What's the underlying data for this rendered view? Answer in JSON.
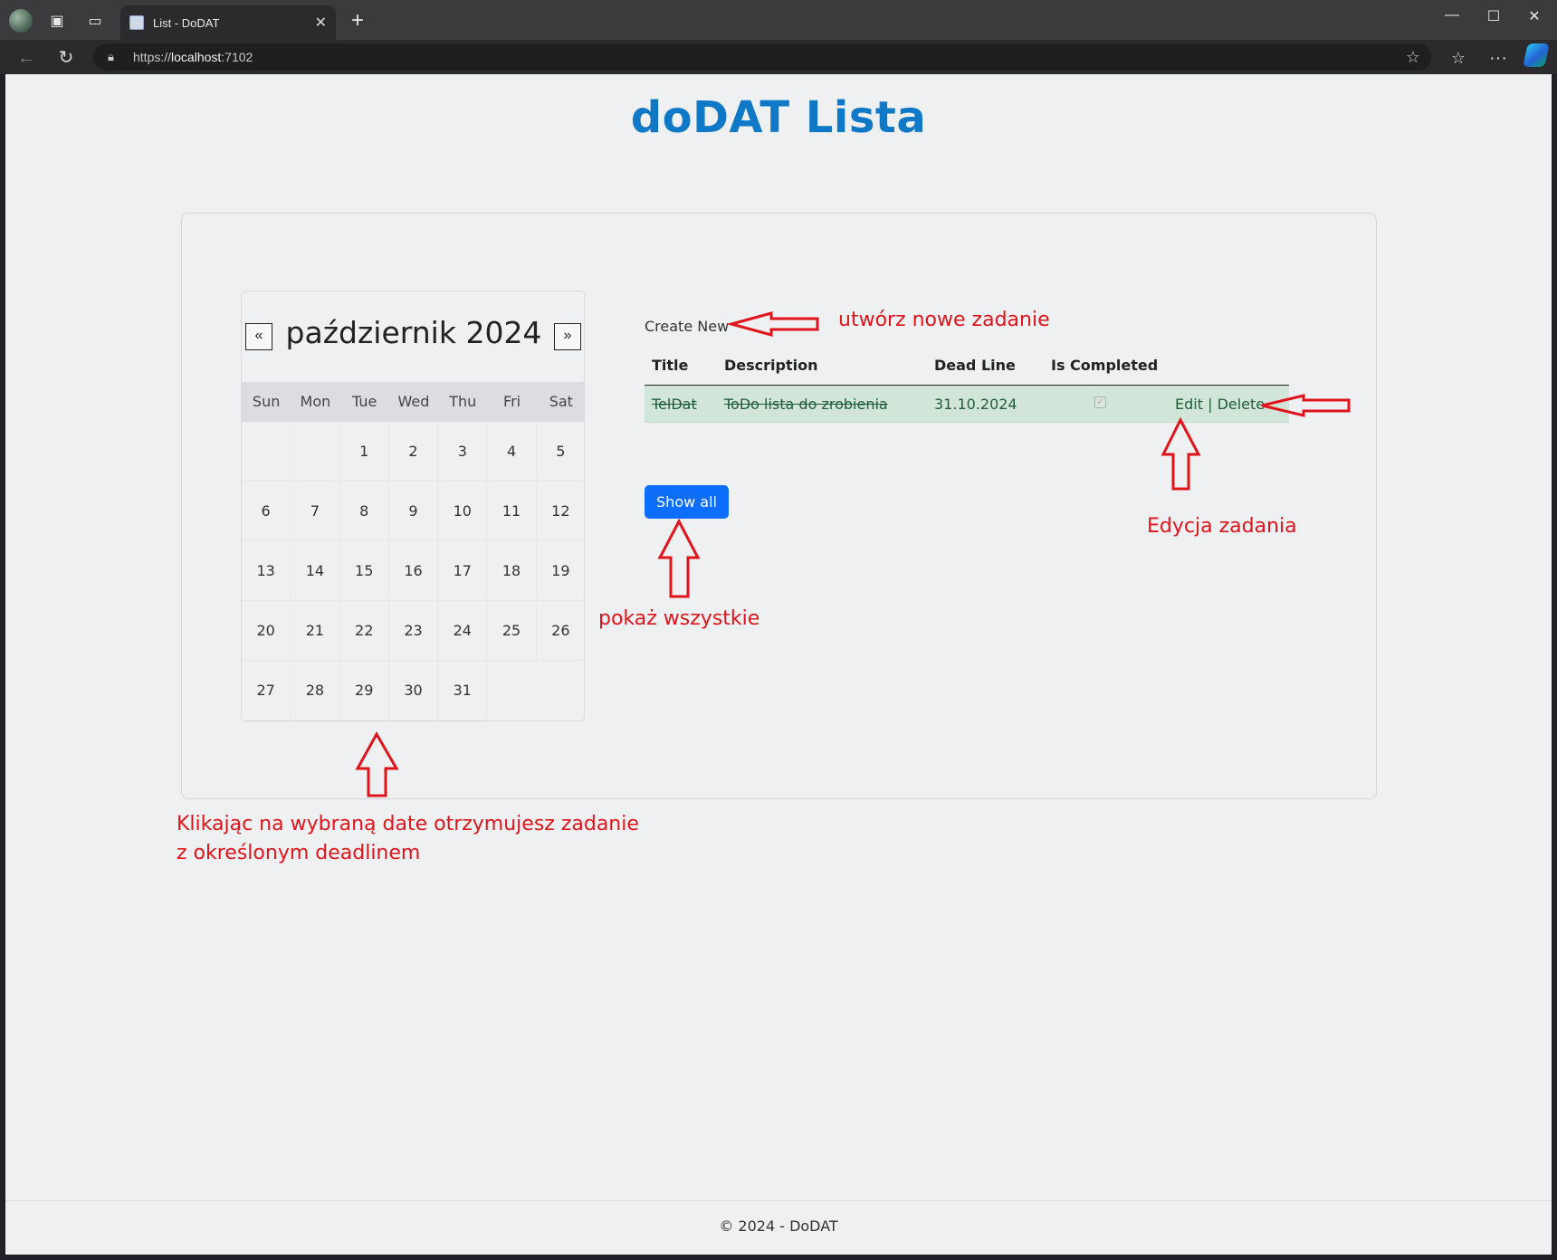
{
  "browser": {
    "tab_title": "List - DoDAT",
    "url_scheme": "https://",
    "url_host": "localhost",
    "url_rest": ":7102"
  },
  "page": {
    "brand": "doDAT Lista",
    "footer": "© 2024 - DoDAT"
  },
  "calendar": {
    "title": "październik 2024",
    "prev_label": "«",
    "next_label": "»",
    "weekdays": [
      "Sun",
      "Mon",
      "Tue",
      "Wed",
      "Thu",
      "Fri",
      "Sat"
    ],
    "first_weekday_index": 2,
    "days_in_month": 31
  },
  "todo": {
    "create_new": "Create New",
    "headers": {
      "title": "Title",
      "description": "Description",
      "deadline": "Dead Line",
      "completed": "Is Completed"
    },
    "rows": [
      {
        "title": "TelDat",
        "description": "ToDo lista do zrobienia",
        "deadline": "31.10.2024",
        "completed": true,
        "edit": "Edit",
        "separator": "|",
        "delete": "Delete"
      }
    ],
    "show_all": "Show all"
  },
  "annotations": {
    "create": "utwórz nowe zadanie",
    "edit": "Edycja zadania",
    "show_all": "pokaż wszystkie",
    "calendar_line1": "Klikając na wybraną date otrzymujesz zadanie",
    "calendar_line2": "z określonym deadlinem",
    "color": "#e2141b"
  }
}
